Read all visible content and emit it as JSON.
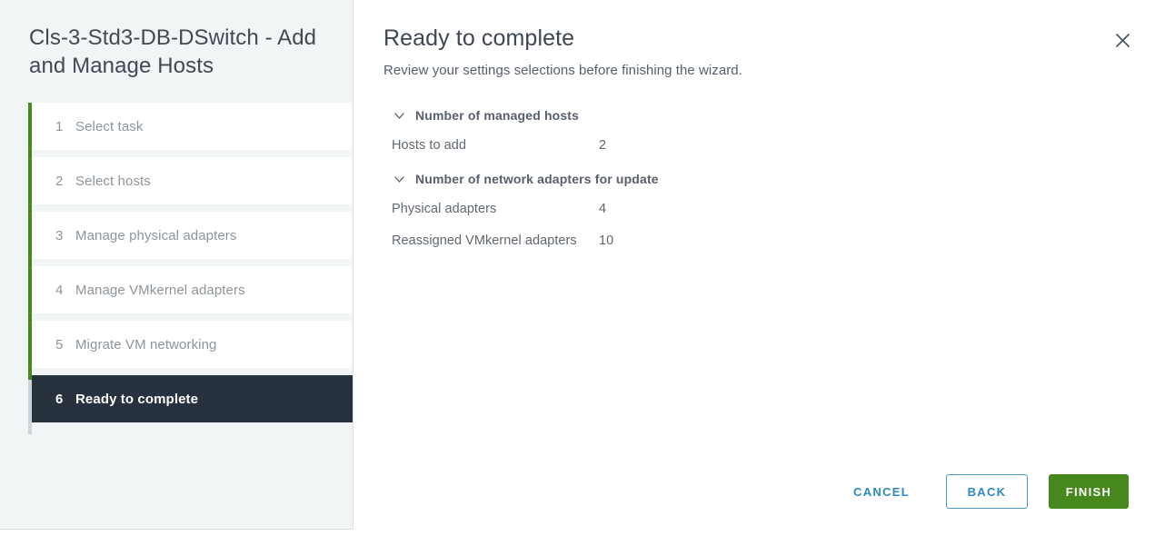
{
  "colors": {
    "accent_blue": "#2d8ac0",
    "finish_green": "#46881d",
    "progress_green": "#488a1b",
    "active_step_bg": "#28323e",
    "sidebar_bg": "#f2f5f6"
  },
  "sidebar": {
    "title": "Cls-3-Std3-DB-DSwitch - Add and Manage Hosts",
    "steps": [
      {
        "num": "1",
        "label": "Select task",
        "active": false
      },
      {
        "num": "2",
        "label": "Select hosts",
        "active": false
      },
      {
        "num": "3",
        "label": "Manage physical adapters",
        "active": false
      },
      {
        "num": "4",
        "label": "Manage VMkernel adapters",
        "active": false
      },
      {
        "num": "5",
        "label": "Migrate VM networking",
        "active": false
      },
      {
        "num": "6",
        "label": "Ready to complete",
        "active": true
      }
    ]
  },
  "main": {
    "heading": "Ready to complete",
    "subtitle": "Review your settings selections before finishing the wizard.",
    "close_icon": "close-icon",
    "groups": [
      {
        "title": "Number of managed hosts",
        "chevron_icon": "chevron-down-icon",
        "expanded": true,
        "rows": [
          {
            "key": "Hosts to add",
            "value": "2"
          }
        ]
      },
      {
        "title": "Number of network adapters for update",
        "chevron_icon": "chevron-down-icon",
        "expanded": true,
        "rows": [
          {
            "key": "Physical adapters",
            "value": "4"
          },
          {
            "key": "Reassigned VMkernel adapters",
            "value": "10"
          }
        ]
      }
    ]
  },
  "footer": {
    "cancel_label": "CANCEL",
    "back_label": "BACK",
    "finish_label": "FINISH"
  }
}
